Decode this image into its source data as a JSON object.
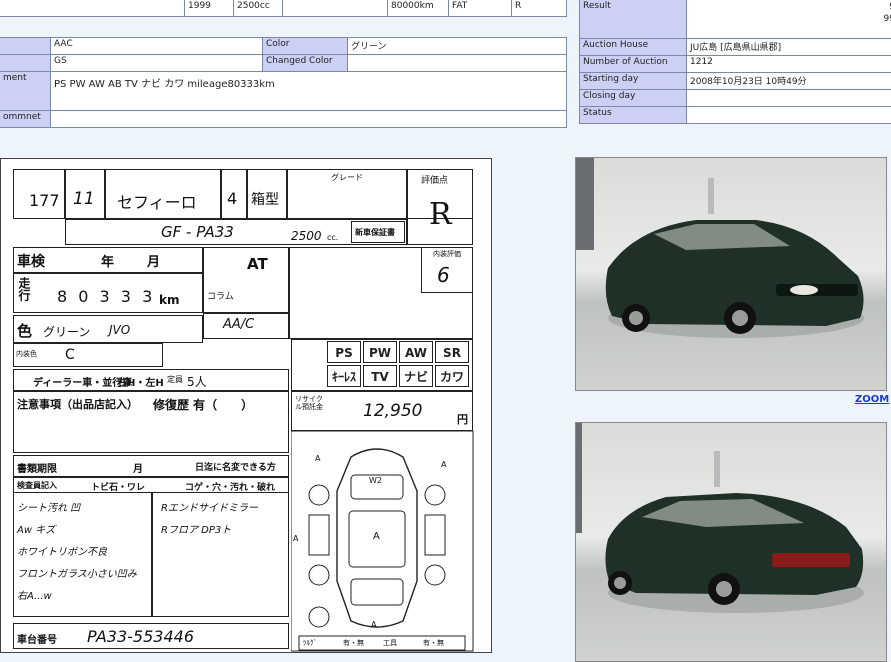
{
  "top_row": {
    "year": "1999",
    "engine": "2500cc",
    "mileage": "80000km",
    "fuel": "FAT",
    "grade_mark": "R"
  },
  "details": [
    {
      "label": "",
      "value": "AAC",
      "label2": "Color",
      "value2": "グリーン"
    },
    {
      "label": "",
      "value": "GS",
      "label2": "Changed Color",
      "value2": ""
    },
    {
      "label": "ment",
      "value": "PS PW AW AB TV ナビ カワ mileage80333km"
    },
    {
      "label": "ommnet",
      "value": ""
    }
  ],
  "auction": {
    "result_label": "Result",
    "result_value_1": "9",
    "result_value_2": "99",
    "rows": [
      {
        "label": "Auction House",
        "value": "JU広島 [広島県山県郡]"
      },
      {
        "label": "Number of Auction",
        "value": "1212"
      },
      {
        "label": "Starting day",
        "value": "2008年10月23日 10時49分"
      },
      {
        "label": "Closing day",
        "value": ""
      },
      {
        "label": "Status",
        "value": ""
      }
    ]
  },
  "sheet": {
    "lot": "177",
    "year_handwritten": "11",
    "model_handwritten": "セフィーロ",
    "doors": "4",
    "body": "箱型",
    "grade_box": "グレード",
    "score_label": "評価点",
    "score": "R",
    "chassis_handwritten": "GF - PA33",
    "displacement": "2500",
    "cc": "cc.",
    "new_reg": "新車保証書",
    "inspection": "車検",
    "year_lbl": "年",
    "month_lbl": "月",
    "kms_lbl": "km",
    "mileage_digits": "8 0 3 3 3",
    "tenure": "走行",
    "shift": "AT",
    "column": "コラム",
    "ac": "AA/C",
    "color_lbl": "色",
    "color_hand": "グリーン",
    "color_code": "JVO",
    "interior_lbl": "内装色",
    "interior_hand": "C",
    "dealer": "ディーラー車・並行車",
    "hand_drive": "右H・左H",
    "capacity": "定員",
    "capacity_hand": "5人",
    "notes_lbl": "注意事項（出品店記入）",
    "repair_lbl": "修復歴 有（　　）",
    "equip": [
      "PS",
      "PW",
      "AW",
      "SR",
      "ｷｰﾚｽ",
      "TV",
      "ナビ",
      "カワ"
    ],
    "recycle_lbl": "リサイクル預託金",
    "recycle_amount": "12,950",
    "yen": "円",
    "docs_lbl": "書類期限",
    "docs_month": "月",
    "docs_day": "日迄に名変できる方",
    "inspector_lbl": "検査員記入",
    "tobi": "トビ石・ワレ",
    "koge": "コゲ・穴・汚れ・破れ",
    "remarks": [
      "シート汚れ 凹",
      "Aw キズ",
      "ホワイトリボン不良",
      "フロントガラス小さい凹み",
      "右A...w"
    ],
    "remarks_right": [
      "Rエンドサイドミラー",
      "Rフロア DP3ト"
    ],
    "frame_lbl": "車台番号",
    "frame_no": "PA33-553446",
    "interior_score": "6",
    "inner_lbl": "内装評価",
    "bottom_labels": [
      "ﾂﾙｸﾞ",
      "有・無",
      "工具",
      "有・無"
    ]
  },
  "zoom": "ZOOM",
  "colors": {
    "label_bg": "#ccd0f4",
    "page_bg": "#eef4fb",
    "link": "#1a3bd1",
    "car": "#1f3126"
  }
}
